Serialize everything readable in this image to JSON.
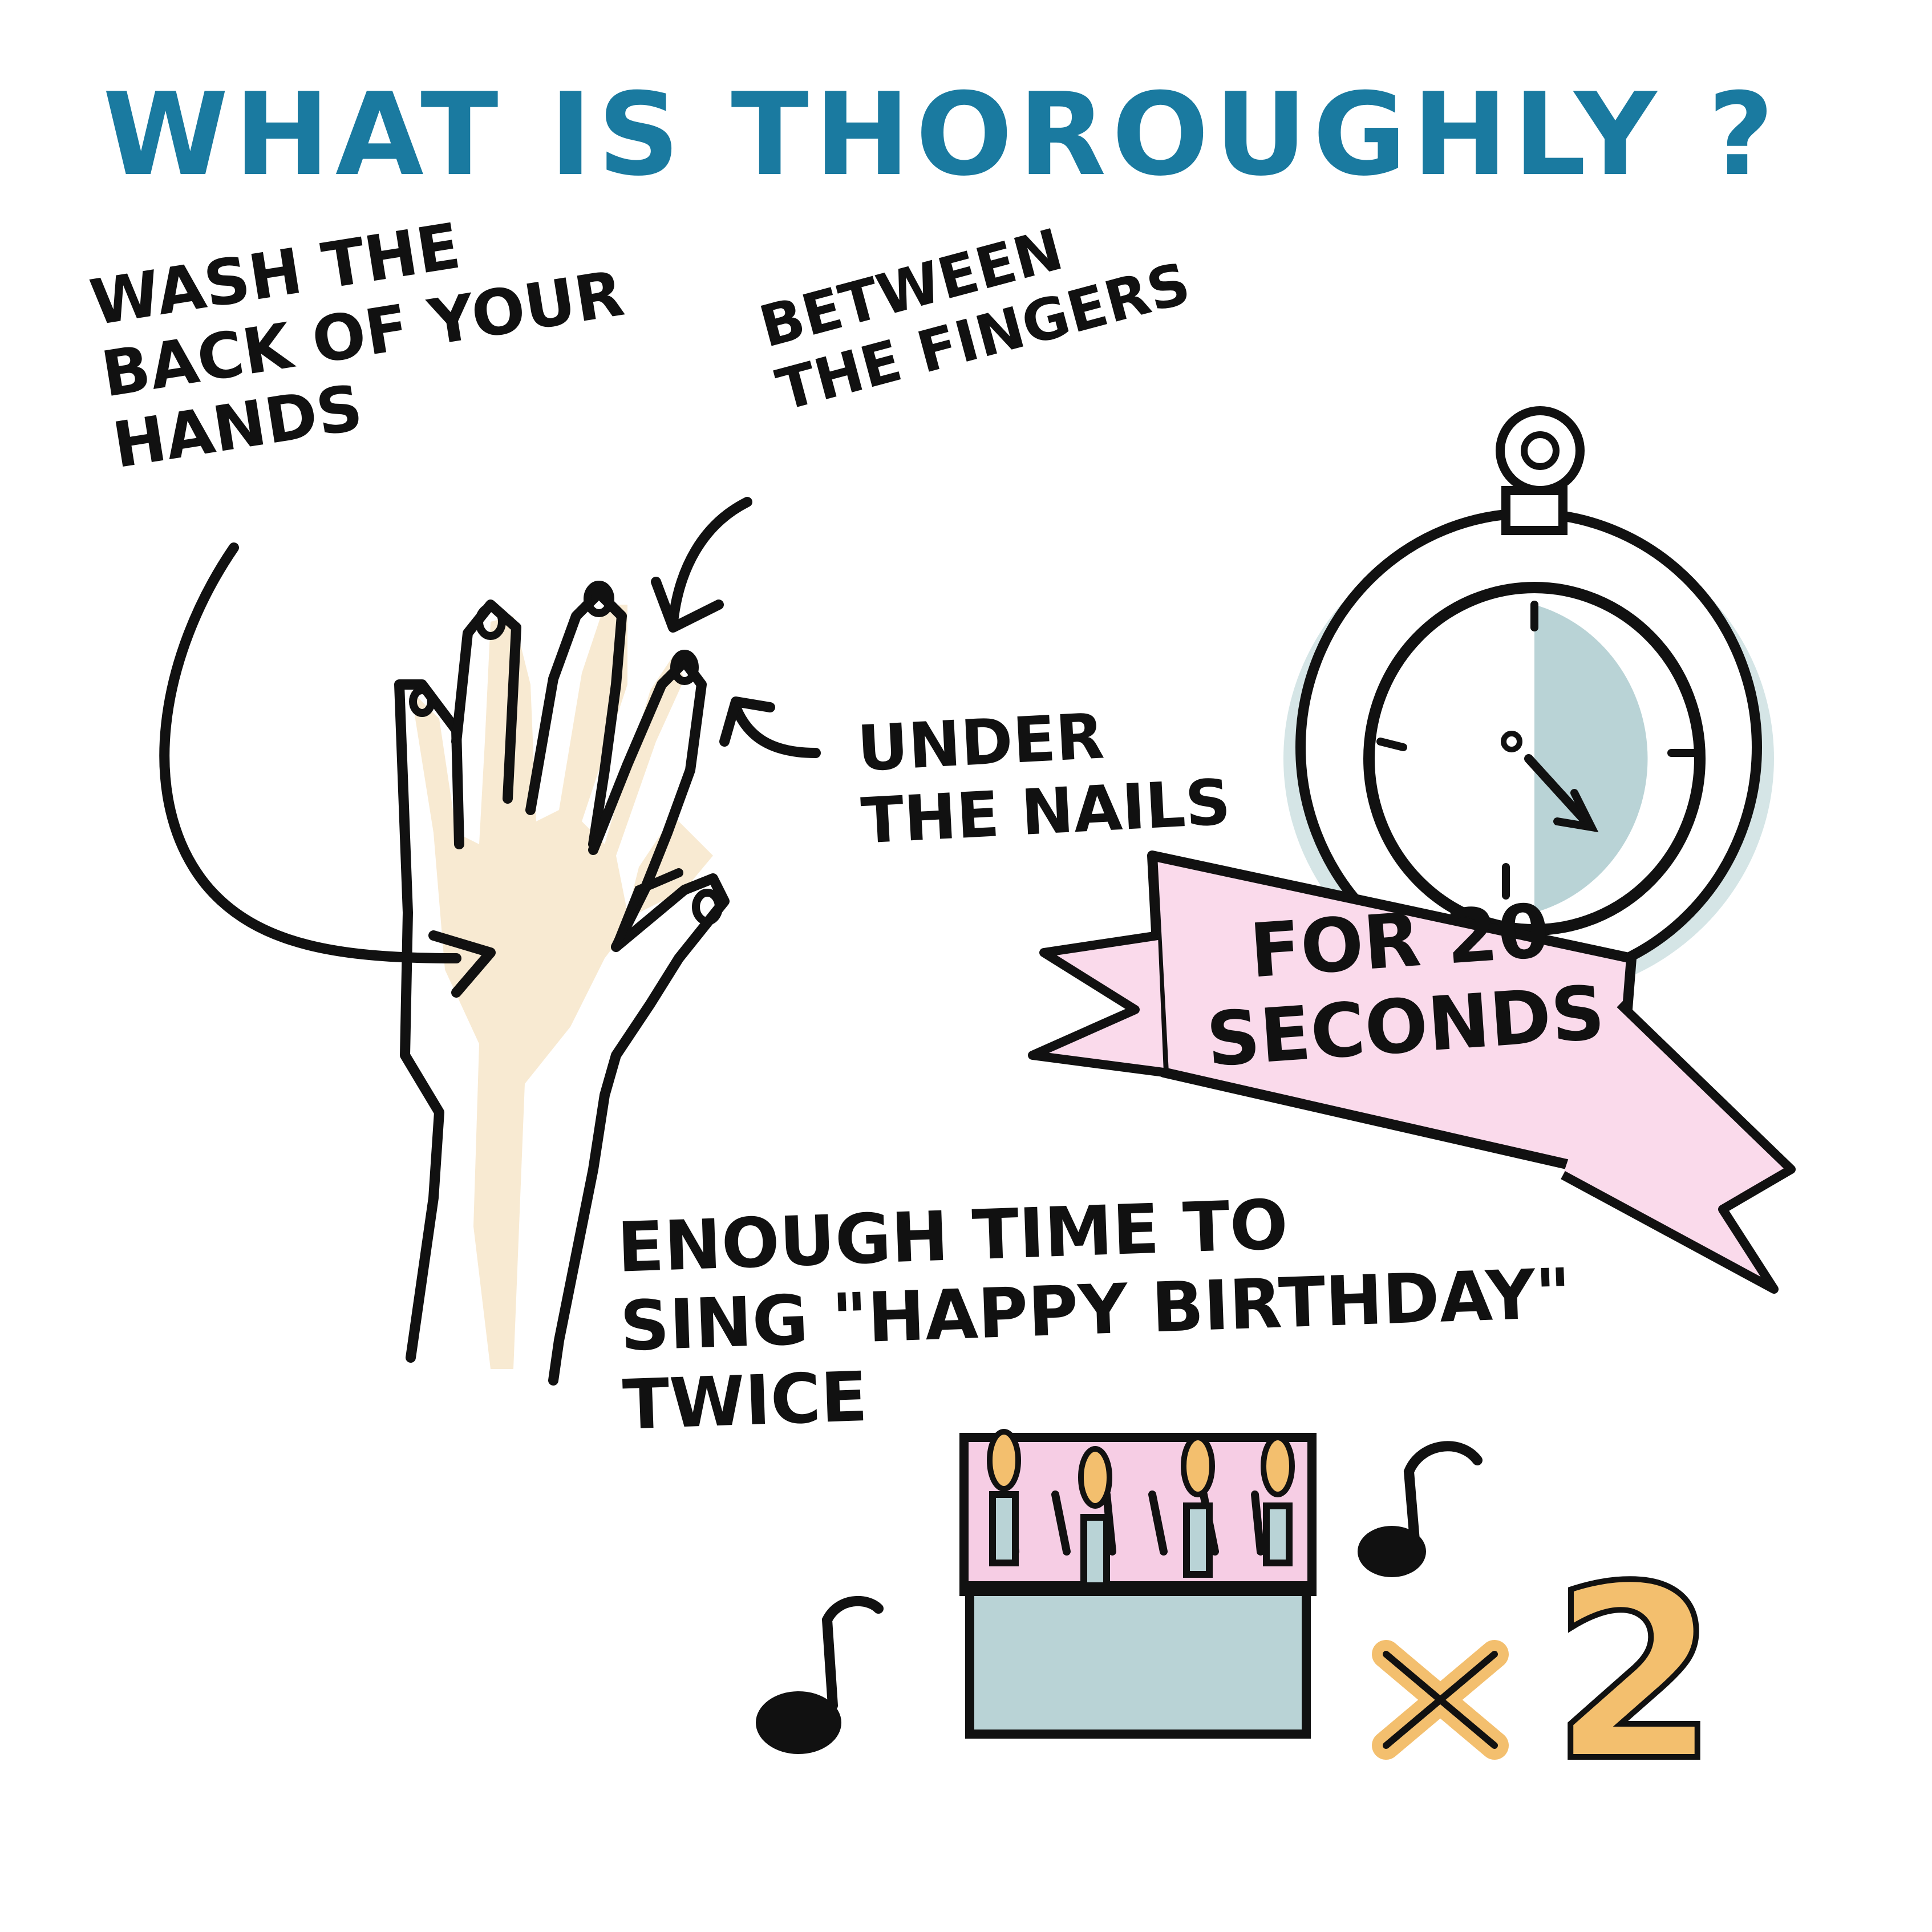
{
  "title": "WHAT IS THOROUGHLY ?",
  "annotations": {
    "back_of_hands": [
      "WASH THE",
      "BACK OF YOUR",
      "HANDS"
    ],
    "between_fingers": [
      "BETWEEN",
      "THE FINGERS"
    ],
    "under_nails": [
      "UNDER",
      "THE NAILS"
    ],
    "duration": [
      "FOR 20",
      "SECONDS"
    ],
    "happy_birthday": [
      "ENOUGH TIME TO",
      "SING \"HAPPY BIRTHDAY\"",
      "TWICE"
    ]
  },
  "multiplier": "x2",
  "colors": {
    "title": "#1a7aa0",
    "ink": "#111111",
    "skin": "#f8ead2",
    "ribbon": "#fadaeb",
    "clock_face": "#b9d3d6",
    "cake_top": "#f6cde4",
    "cake_base": "#b9d3d6",
    "flame": "#f3bf6e",
    "multiplier": "#f3bf6e"
  },
  "icons": [
    "hand-icon",
    "stopwatch-icon",
    "ribbon-banner-icon",
    "birthday-cake-icon",
    "music-note-icon"
  ]
}
